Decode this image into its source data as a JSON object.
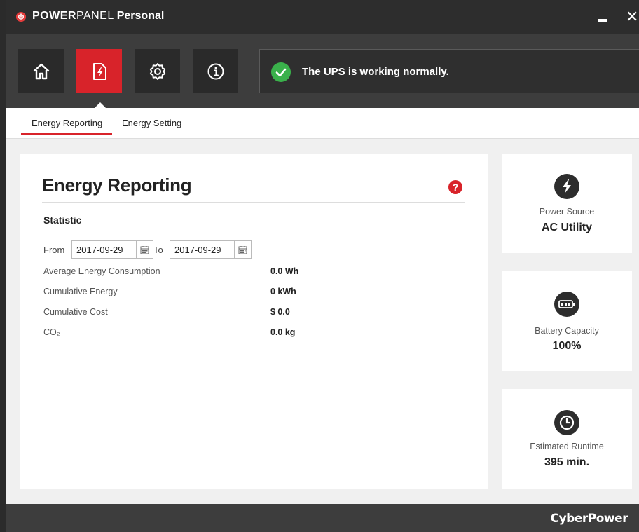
{
  "app": {
    "title_part1": "POWER",
    "title_part2": "PANEL",
    "title_part3": "Personal",
    "brand_color": "#d8232a"
  },
  "toolbar": {
    "buttons": [
      {
        "icon": "home-icon"
      },
      {
        "icon": "energy-report-icon",
        "active": true
      },
      {
        "icon": "gear-icon"
      },
      {
        "icon": "info-icon"
      }
    ],
    "status_icon": "check-circle-icon",
    "status_color": "#3ab14b",
    "status_message": "The UPS is working normally."
  },
  "tabs": [
    {
      "label": "Energy Reporting",
      "active": true
    },
    {
      "label": "Energy Setting",
      "active": false
    }
  ],
  "main": {
    "title": "Energy Reporting",
    "help_label": "?",
    "section": "Statistic",
    "from_label": "From",
    "from_date": "2017-09-29",
    "to_label": "To",
    "to_date": "2017-09-29",
    "stats": [
      {
        "label": "Average Energy Consumption",
        "value": "0.0 Wh"
      },
      {
        "label": "Cumulative Energy",
        "value": "0 kWh"
      },
      {
        "label": "Cumulative Cost",
        "value": "$ 0.0"
      },
      {
        "label": "CO₂",
        "value": "0.0 kg"
      }
    ]
  },
  "side": {
    "power_source": {
      "label": "Power Source",
      "value": "AC Utility",
      "icon": "lightning-icon"
    },
    "battery": {
      "label": "Battery Capacity",
      "value": "100%",
      "icon": "battery-icon"
    },
    "runtime": {
      "label": "Estimated Runtime",
      "value": "395 min.",
      "icon": "clock-icon"
    }
  },
  "footer": {
    "brand": "CyberPower"
  }
}
